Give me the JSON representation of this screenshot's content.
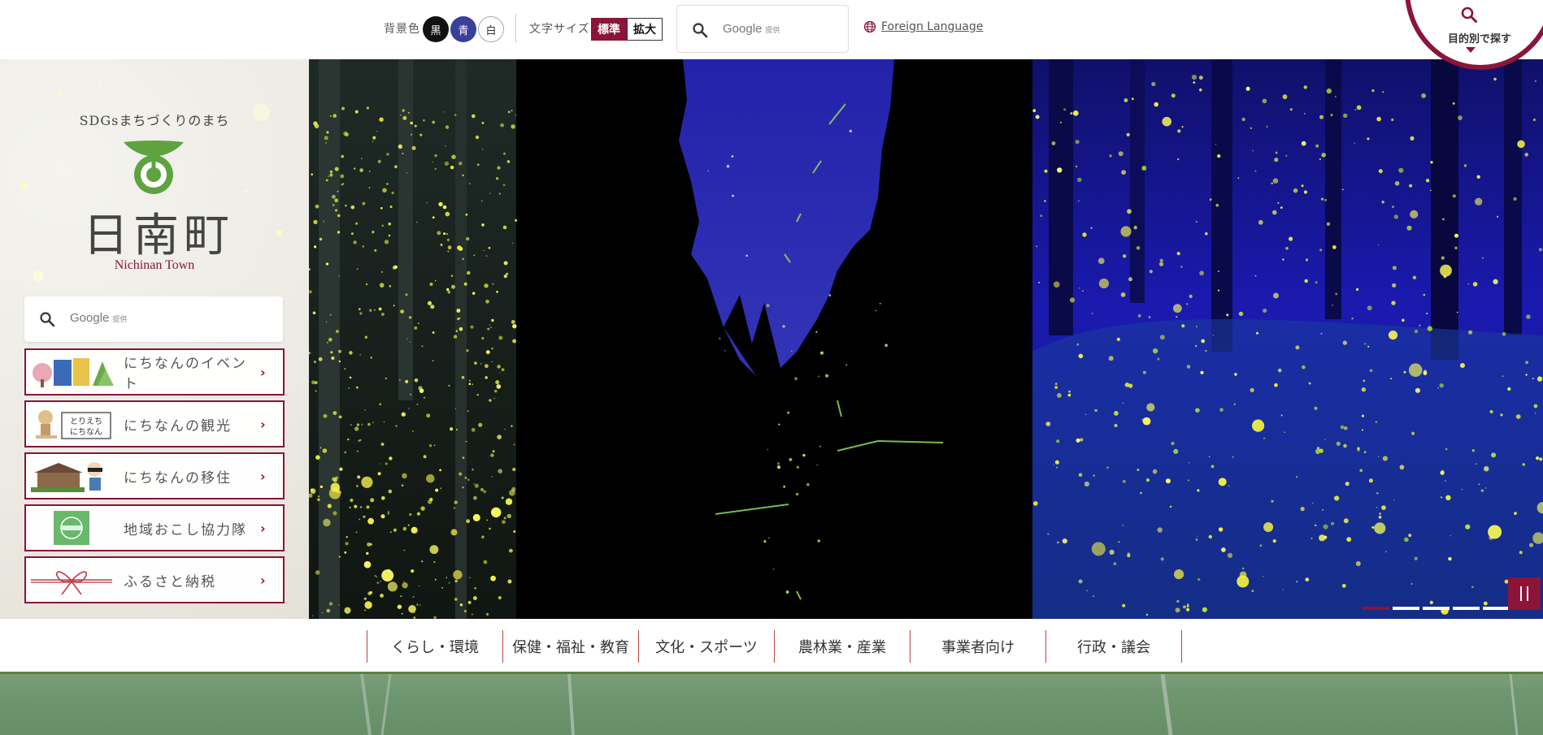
{
  "header": {
    "bg_color_label": "背景色",
    "bg_options": [
      {
        "label": "黒",
        "bg": "#111111",
        "fg": "#ffffff"
      },
      {
        "label": "青",
        "bg": "#3a3f9a",
        "fg": "#ffffff"
      },
      {
        "label": "白",
        "bg": "#ffffff",
        "fg": "#333333"
      }
    ],
    "font_size_label": "文字サイズ",
    "font_standard": "標準",
    "font_large": "拡大",
    "search_provider": "Google",
    "search_provider_suffix": "提供",
    "foreign_language": "Foreign Language",
    "purpose_search": "目的別で探す"
  },
  "brand": {
    "tagline": "SDGsまちづくりのまち",
    "town_name": "日南町",
    "town_name_en": "Nichinan Town"
  },
  "side_search": {
    "provider": "Google",
    "suffix": "提供"
  },
  "quick_links": [
    {
      "label": "にちなんのイベント",
      "thumb": "event-illustration-icon"
    },
    {
      "label": "にちなんの観光",
      "thumb": "tourism-mascot-icon"
    },
    {
      "label": "にちなんの移住",
      "thumb": "relocation-illustration-icon"
    },
    {
      "label": "地域おこし協力隊",
      "thumb": "community-badge-icon"
    },
    {
      "label": "ふるさと納税",
      "thumb": "ribbon-icon"
    }
  ],
  "nav": {
    "items": [
      "くらし・環境",
      "保健・福祉・教育",
      "文化・スポーツ",
      "農林業・産業",
      "事業者向け",
      "行政・議会"
    ]
  },
  "slider": {
    "slide_count": 5,
    "active_index": 0
  },
  "colors": {
    "accent": "#8a1538",
    "green": "#5f7f3f",
    "logo_green": "#5ea33f"
  }
}
